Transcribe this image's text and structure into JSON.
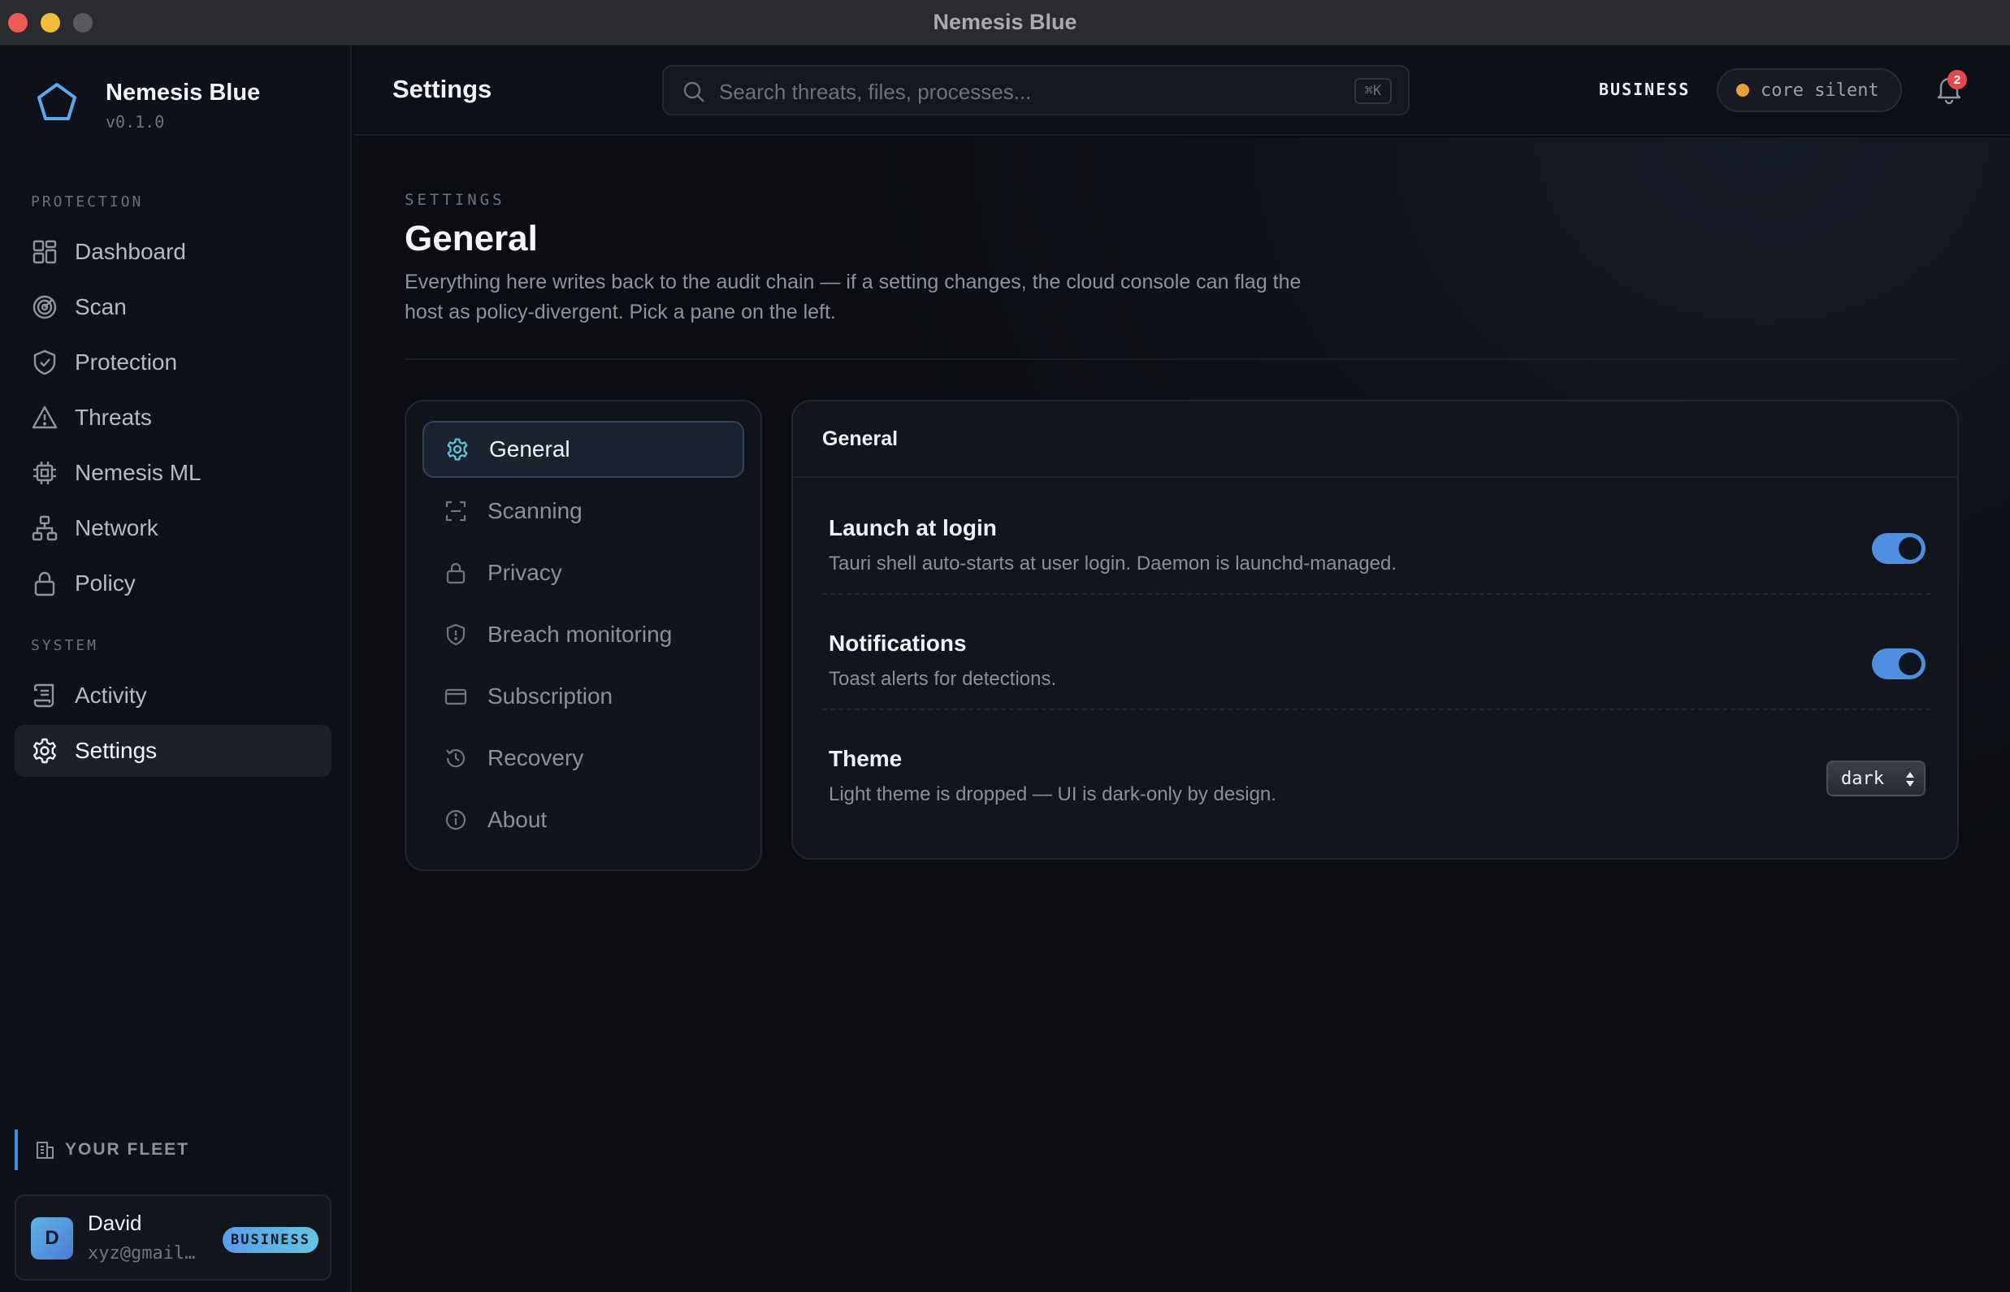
{
  "window": {
    "title": "Nemesis Blue"
  },
  "brand": {
    "name": "Nemesis Blue",
    "version": "v0.1.0"
  },
  "sidebar": {
    "sections": [
      {
        "label": "PROTECTION"
      },
      {
        "label": "SYSTEM"
      }
    ],
    "items": [
      {
        "label": "Dashboard",
        "icon": "dashboard-icon",
        "active": false
      },
      {
        "label": "Scan",
        "icon": "radar-icon",
        "active": false
      },
      {
        "label": "Protection",
        "icon": "shield-check-icon",
        "active": false
      },
      {
        "label": "Threats",
        "icon": "warning-icon",
        "active": false
      },
      {
        "label": "Nemesis ML",
        "icon": "chip-icon",
        "active": false
      },
      {
        "label": "Network",
        "icon": "network-icon",
        "active": false
      },
      {
        "label": "Policy",
        "icon": "lock-icon",
        "active": false
      },
      {
        "label": "Activity",
        "icon": "scroll-icon",
        "active": false
      },
      {
        "label": "Settings",
        "icon": "gear-icon",
        "active": true
      }
    ],
    "fleet_label": "YOUR FLEET",
    "user": {
      "initial": "D",
      "name": "David",
      "email": "xyz@gmail…",
      "plan": "BUSINESS"
    }
  },
  "topbar": {
    "title": "Settings",
    "search_placeholder": "Search threats, files, processes...",
    "search_shortcut": "⌘K",
    "plan": "BUSINESS",
    "core_status": "core silent",
    "notification_count": "2"
  },
  "page": {
    "eyebrow": "SETTINGS",
    "title": "General",
    "description": "Everything here writes back to the audit chain — if a setting changes, the cloud console can flag the host as policy-divergent. Pick a pane on the left."
  },
  "panes": [
    {
      "label": "General",
      "icon": "gear-icon",
      "active": true
    },
    {
      "label": "Scanning",
      "icon": "scan-frame-icon",
      "active": false
    },
    {
      "label": "Privacy",
      "icon": "lock-icon",
      "active": false
    },
    {
      "label": "Breach monitoring",
      "icon": "shield-alert-icon",
      "active": false
    },
    {
      "label": "Subscription",
      "icon": "credit-card-icon",
      "active": false
    },
    {
      "label": "Recovery",
      "icon": "history-icon",
      "active": false
    },
    {
      "label": "About",
      "icon": "info-icon",
      "active": false
    }
  ],
  "panel": {
    "title": "General",
    "settings": [
      {
        "title": "Launch at login",
        "description": "Tauri shell auto-starts at user login. Daemon is launchd-managed.",
        "control": "toggle",
        "value": true
      },
      {
        "title": "Notifications",
        "description": "Toast alerts for detections.",
        "control": "toggle",
        "value": true
      },
      {
        "title": "Theme",
        "description": "Light theme is dropped — UI is dark-only by design.",
        "control": "select",
        "value": "dark"
      }
    ]
  },
  "colors": {
    "accent": "#4f8fe0",
    "status_dot": "#e9a03b",
    "badge_red": "#e5484d"
  }
}
